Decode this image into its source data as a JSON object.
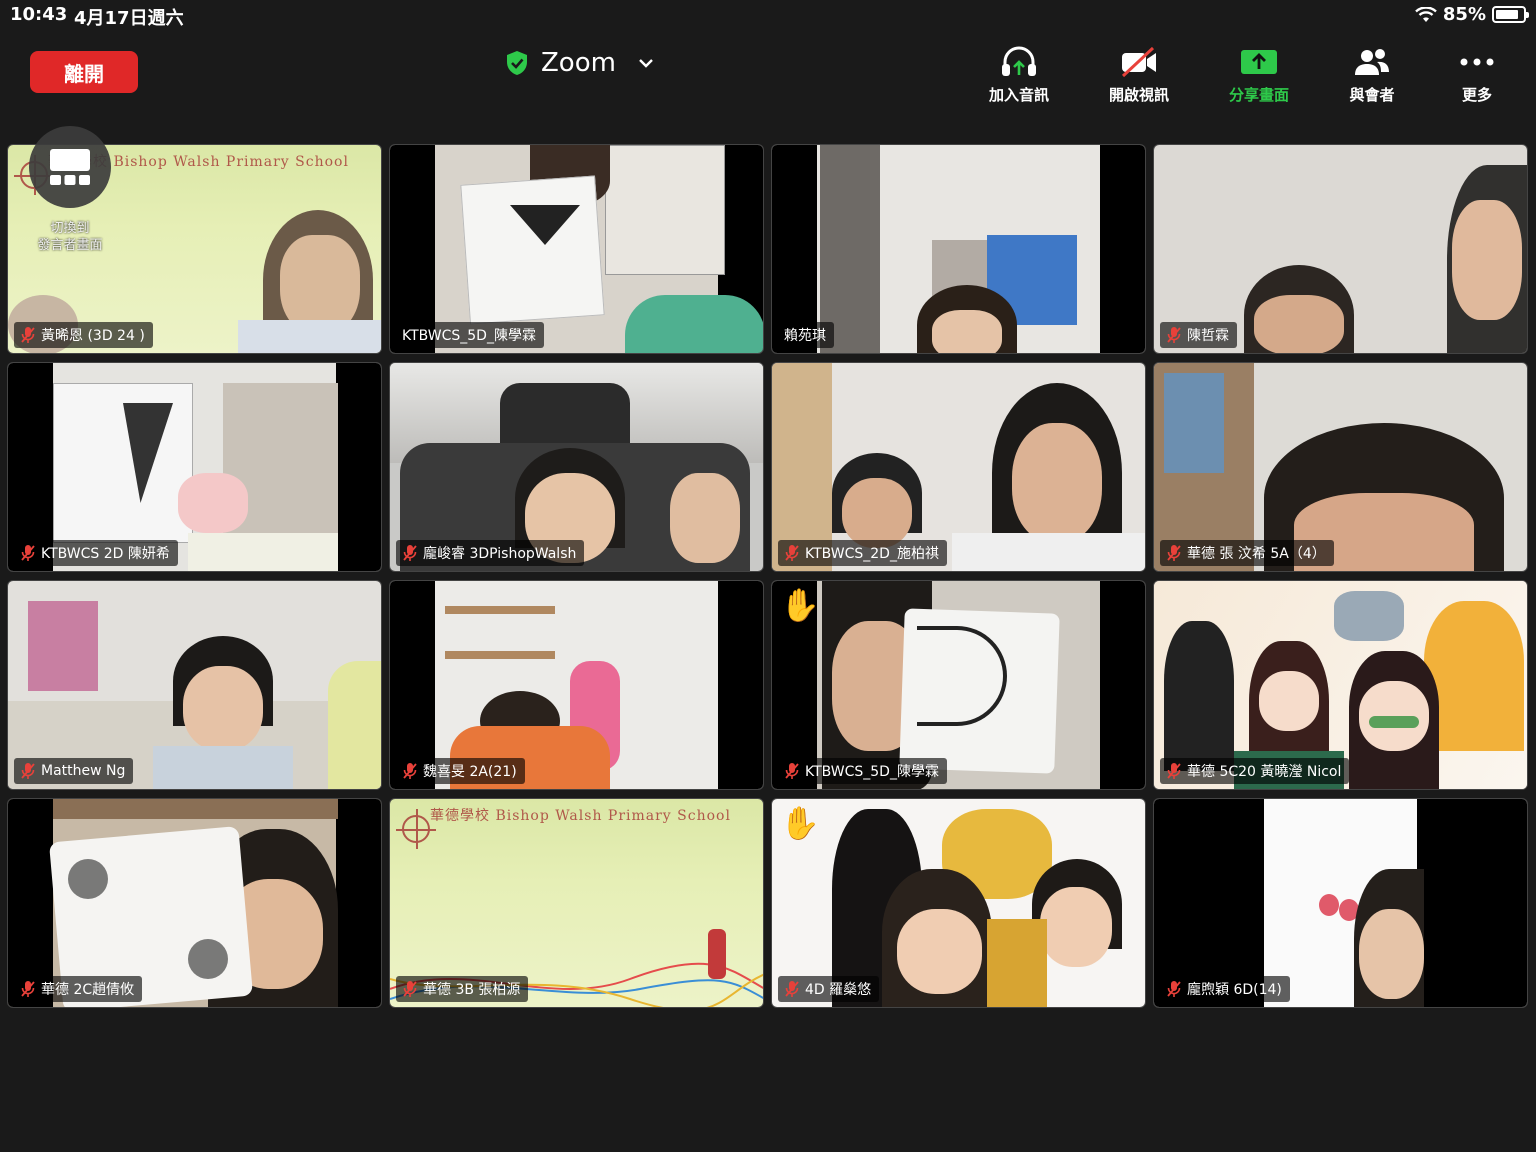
{
  "status_bar": {
    "time": "10:43",
    "date": "4月17日週六",
    "battery_percent": "85%",
    "battery_level": 0.85
  },
  "toolbar": {
    "leave_label": "離開",
    "meeting_title": "Zoom",
    "buttons": [
      {
        "label": "加入音訊",
        "icon": "headphones-icon"
      },
      {
        "label": "開啟視訊",
        "icon": "video-off-icon"
      },
      {
        "label": "分享畫面",
        "icon": "share-screen-icon"
      },
      {
        "label": "與會者",
        "icon": "participants-icon"
      },
      {
        "label": "更多",
        "icon": "more-icon"
      }
    ],
    "share_color": "#2ec94a",
    "leave_color": "#e02828"
  },
  "switch_view": {
    "label_line1": "切換到",
    "label_line2": "發言者畫面"
  },
  "school_banner": "華德學校 Bishop Walsh Primary School",
  "participants": [
    {
      "name": "黃晞恩 (3D 24 )",
      "muted": true,
      "raised_hand": false
    },
    {
      "name": "KTBWCS_5D_陳學霖",
      "muted": false,
      "raised_hand": false
    },
    {
      "name": "賴苑琪",
      "muted": false,
      "raised_hand": false
    },
    {
      "name": "陳哲霖",
      "muted": true,
      "raised_hand": false
    },
    {
      "name": "KTBWCS 2D 陳妍希",
      "muted": true,
      "raised_hand": false
    },
    {
      "name": "龐峻睿 3DPishopWalsh",
      "muted": true,
      "raised_hand": false
    },
    {
      "name": "KTBWCS_2D_施柏祺",
      "muted": true,
      "raised_hand": false
    },
    {
      "name": "華德 張 汶希 5A（4）",
      "muted": true,
      "raised_hand": false
    },
    {
      "name": "Matthew Ng",
      "muted": true,
      "raised_hand": false
    },
    {
      "name": "魏喜旻 2A(21)",
      "muted": true,
      "raised_hand": false
    },
    {
      "name": "KTBWCS_5D_陳學霖",
      "muted": true,
      "raised_hand": true
    },
    {
      "name": "華德 5C20 黃曉瀅 Nicol",
      "muted": true,
      "raised_hand": false
    },
    {
      "name": "華德   2C趙倩攸",
      "muted": true,
      "raised_hand": false
    },
    {
      "name": "華德 3B 張柏源",
      "muted": true,
      "raised_hand": false
    },
    {
      "name": "4D 羅燊悠",
      "muted": true,
      "raised_hand": true
    },
    {
      "name": "龐煦穎 6D(14)",
      "muted": true,
      "raised_hand": false
    }
  ],
  "colors": {
    "background": "#1a1a1a",
    "muted_red": "#e8413a"
  }
}
